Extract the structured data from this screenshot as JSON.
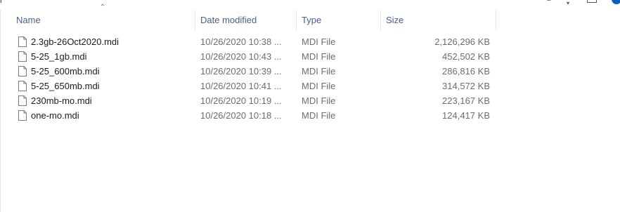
{
  "window": {
    "title_fragment": "r"
  },
  "columns": {
    "name": "Name",
    "date_modified": "Date modified",
    "type": "Type",
    "size": "Size"
  },
  "sort": {
    "column": "Name",
    "direction": "ascending",
    "icon": "sort-up-arrow-icon"
  },
  "files": [
    {
      "name": "2.3gb-26Oct2020.mdi",
      "date": "10/26/2020 10:38 ...",
      "type": "MDI File",
      "size": "2,126,296 KB",
      "icon": "document-file-icon"
    },
    {
      "name": "5-25_1gb.mdi",
      "date": "10/26/2020 10:43 ...",
      "type": "MDI File",
      "size": "452,502 KB",
      "icon": "document-file-icon"
    },
    {
      "name": "5-25_600mb.mdi",
      "date": "10/26/2020 10:39 ...",
      "type": "MDI File",
      "size": "286,816 KB",
      "icon": "document-file-icon"
    },
    {
      "name": "5-25_650mb.mdi",
      "date": "10/26/2020 10:41 ...",
      "type": "MDI File",
      "size": "314,572 KB",
      "icon": "document-file-icon"
    },
    {
      "name": "230mb-mo.mdi",
      "date": "10/26/2020 10:19 ...",
      "type": "MDI File",
      "size": "223,167 KB",
      "icon": "document-file-icon"
    },
    {
      "name": "one-mo.mdi",
      "date": "10/26/2020 10:18 ...",
      "type": "MDI File",
      "size": "124,417 KB",
      "icon": "document-file-icon"
    }
  ],
  "colors": {
    "header_text": "#4d6082",
    "name_text": "#1b1b1b",
    "detail_text": "#6d6d6d",
    "accent": "#0b5fc4"
  }
}
